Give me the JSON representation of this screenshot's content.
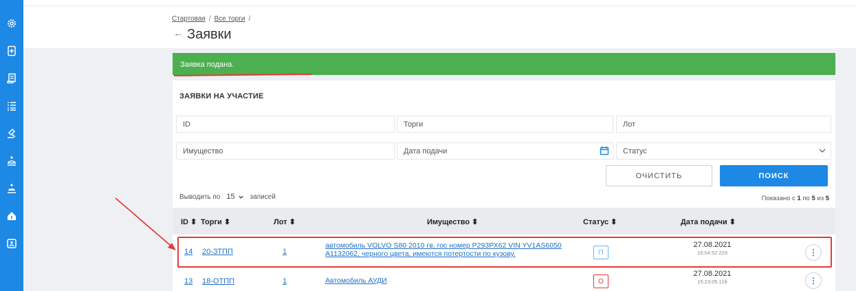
{
  "sidebar": {
    "items": [
      {
        "icon": "settings-gear-icon"
      },
      {
        "icon": "document-add-icon"
      },
      {
        "icon": "scroll-document-icon"
      },
      {
        "icon": "list-icon"
      },
      {
        "icon": "gavel-icon"
      },
      {
        "icon": "bell-person-icon"
      },
      {
        "icon": "bell-icon"
      },
      {
        "icon": "home-currency-icon"
      },
      {
        "icon": "contacts-icon"
      }
    ]
  },
  "breadcrumb": {
    "home": "Стартовая",
    "sep1": "/",
    "all_tenders": "Все торги",
    "sep2": "/"
  },
  "page": {
    "back_icon": "←",
    "title": "Заявки"
  },
  "banner": {
    "text": "Заявка подана."
  },
  "card": {
    "title": "ЗАЯВКИ НА УЧАСТИЕ"
  },
  "filters": {
    "id_placeholder": "ID",
    "tender_placeholder": "Торги",
    "lot_placeholder": "Лот",
    "property_placeholder": "Имущество",
    "date_placeholder": "Дата подачи",
    "status_placeholder": "Статус"
  },
  "buttons": {
    "clear": "ОЧИСТИТЬ",
    "search": "ПОИСК"
  },
  "pagination": {
    "show_label": "Выводить по",
    "per_page_value": "15",
    "records_label": "записей",
    "shown_prefix": "Показано с",
    "shown_from": "1",
    "shown_mid": "по",
    "shown_to": "5",
    "shown_of": "из",
    "shown_total": "5"
  },
  "table": {
    "headers": {
      "id": "ID ⬍",
      "tender": "Торги ⬍",
      "lot": "Лот ⬍",
      "property": "Имущество ⬍",
      "status": "Статус ⬍",
      "date": "Дата подачи ⬍"
    },
    "rows": [
      {
        "id": "14",
        "tender": "20-ЗТПП",
        "lot": "1",
        "property_line1": "автомобиль VOLVO S80 2010 гв, гос номер Р293РХ62 VIN YV1AS6050",
        "property_line2": "A1132062, черного цвета, имеются потертости по кузову.",
        "status": "П",
        "status_color": "#64b5f6",
        "date": "27.08.2021",
        "time": "15:54:52.229"
      },
      {
        "id": "13",
        "tender": "18-ОТПП",
        "lot": "1",
        "property_line1": "Автомобиль АУДИ",
        "property_line2": "",
        "status": "О",
        "status_color": "#e53935",
        "date": "27.08.2021",
        "time": "15:23:05.118"
      }
    ]
  },
  "colors": {
    "sidebar": "#1e88e5",
    "banner": "#4caf50",
    "annotation": "#e53935",
    "link": "#1e6fc8"
  }
}
